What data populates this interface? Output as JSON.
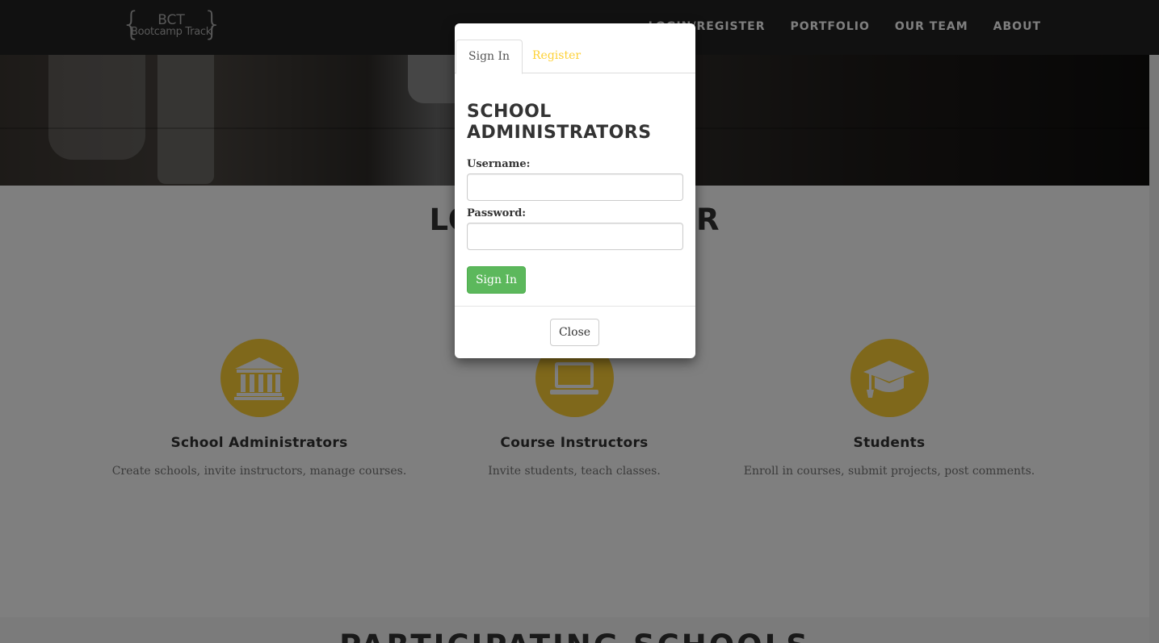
{
  "navbar": {
    "logo": {
      "abbr": "BCT",
      "full": "Bootcamp Track",
      "brace_left": "{",
      "brace_right": "}"
    },
    "links": [
      "LOGIN/REGISTER",
      "PORTFOLIO",
      "OUR TEAM",
      "ABOUT"
    ]
  },
  "main": {
    "heading": "LOGIN/REGISTER",
    "features": [
      {
        "icon": "institution-icon",
        "title": "School Administrators",
        "description": "Create schools, invite instructors, manage courses."
      },
      {
        "icon": "laptop-icon",
        "title": "Course Instructors",
        "description": "Invite students, teach classes."
      },
      {
        "icon": "graduation-cap-icon",
        "title": "Students",
        "description": "Enroll in courses, submit projects, post comments."
      }
    ]
  },
  "bottom_section": {
    "heading": "PARTICIPATING SCHOOLS"
  },
  "modal": {
    "tabs": [
      "Sign In",
      "Register"
    ],
    "active_tab": "Sign In",
    "title": "SCHOOL ADMINISTRATORS",
    "username_label": "Username:",
    "username_value": "",
    "password_label": "Password:",
    "password_value": "",
    "submit_label": "Sign In",
    "close_label": "Close"
  },
  "colors": {
    "accent": "#fed136",
    "success": "#5cb85c",
    "navbar": "#222222"
  }
}
